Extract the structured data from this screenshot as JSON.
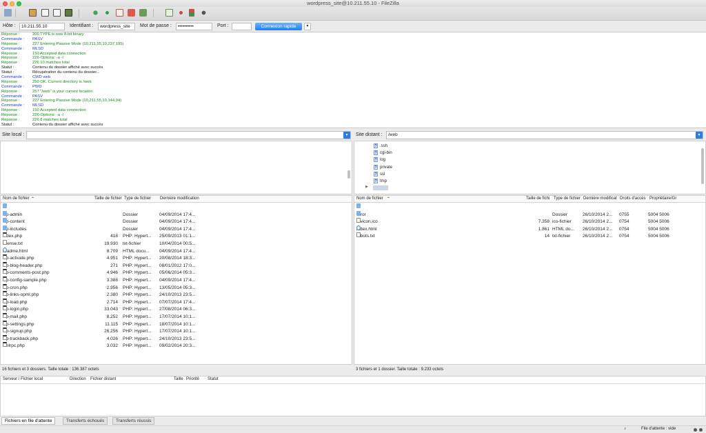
{
  "window": {
    "title": "wordpress_site@10.211.55.10 - FileZilla"
  },
  "quickconnect": {
    "host_label": "Hôte :",
    "host_value": "10.211.55.10",
    "user_label": "Identifiant :",
    "user_value": "wordpress_site",
    "pass_label": "Mot de passe :",
    "pass_value": "••••••••••",
    "port_label": "Port :",
    "port_value": "",
    "connect_label": "Connexion rapide",
    "dropdown_glyph": "▼"
  },
  "log": [
    {
      "k": "Réponse :",
      "v": "200 TYPE is now 8-bit binary",
      "t": "rep"
    },
    {
      "k": "Commande :",
      "v": "PASV",
      "t": "cmd"
    },
    {
      "k": "Réponse :",
      "v": "227 Entering Passive Mode (10,211,55,10,237,195)",
      "t": "rep"
    },
    {
      "k": "Commande :",
      "v": "MLSD",
      "t": "cmd"
    },
    {
      "k": "Réponse :",
      "v": "150 Accepted data connection",
      "t": "rep"
    },
    {
      "k": "Réponse :",
      "v": "226-Options: -a -l",
      "t": "rep"
    },
    {
      "k": "Réponse :",
      "v": "226 10 matches total",
      "t": "rep"
    },
    {
      "k": "Statut :",
      "v": "Contenu du dossier affiché avec succès",
      "t": "stat"
    },
    {
      "k": "Statut :",
      "v": "Récupération du contenu du dossier...",
      "t": "stat"
    },
    {
      "k": "Commande :",
      "v": "CWD web",
      "t": "cmd"
    },
    {
      "k": "Réponse :",
      "v": "250 OK. Current directory is /web",
      "t": "rep"
    },
    {
      "k": "Commande :",
      "v": "PWD",
      "t": "cmd"
    },
    {
      "k": "Réponse :",
      "v": "257 \"/web\" is your current location",
      "t": "rep"
    },
    {
      "k": "Commande :",
      "v": "PASV",
      "t": "cmd"
    },
    {
      "k": "Réponse :",
      "v": "227 Entering Passive Mode (10,211,55,10,144,94)",
      "t": "rep"
    },
    {
      "k": "Commande :",
      "v": "MLSD",
      "t": "cmd"
    },
    {
      "k": "Réponse :",
      "v": "150 Accepted data connection",
      "t": "rep"
    },
    {
      "k": "Réponse :",
      "v": "226-Options: -a -l",
      "t": "rep"
    },
    {
      "k": "Réponse :",
      "v": "226 8 matches total",
      "t": "rep"
    },
    {
      "k": "Statut :",
      "v": "Contenu du dossier affiché avec succès",
      "t": "stat"
    }
  ],
  "local": {
    "site_label": "Site local :",
    "site_value": "",
    "headers": {
      "name": "Nom de fichier",
      "size": "Taille de fichier",
      "type": "Type de fichier",
      "modified": "Dernière modification"
    },
    "files": [
      {
        "name": "..",
        "size": "",
        "type": "",
        "modified": "",
        "icon": "folder"
      },
      {
        "name": "wp-admin",
        "size": "",
        "type": "Dossier",
        "modified": "04/09/2014 17:4...",
        "icon": "folder"
      },
      {
        "name": "wp-content",
        "size": "",
        "type": "Dossier",
        "modified": "04/09/2014 17:4...",
        "icon": "folder"
      },
      {
        "name": "wp-includes",
        "size": "",
        "type": "Dossier",
        "modified": "04/09/2014 17:4...",
        "icon": "folder"
      },
      {
        "name": "index.php",
        "size": "418",
        "type": "PHP: Hypert...",
        "modified": "25/09/2013 01:1...",
        "icon": "php"
      },
      {
        "name": "license.txt",
        "size": "19.930",
        "type": "txt-fichier",
        "modified": "10/04/2014 00:5...",
        "icon": "file"
      },
      {
        "name": "readme.html",
        "size": "8.709",
        "type": "HTML docu...",
        "modified": "04/09/2014 17:4...",
        "icon": "html"
      },
      {
        "name": "wp-activate.php",
        "size": "4.951",
        "type": "PHP: Hypert...",
        "modified": "20/08/2014 18:3...",
        "icon": "php"
      },
      {
        "name": "wp-blog-header.php",
        "size": "271",
        "type": "PHP: Hypert...",
        "modified": "08/01/2012 17:0...",
        "icon": "php"
      },
      {
        "name": "wp-comments-post.php",
        "size": "4.946",
        "type": "PHP: Hypert...",
        "modified": "05/06/2014 05:3...",
        "icon": "php"
      },
      {
        "name": "wp-config-sample.php",
        "size": "3.388",
        "type": "PHP: Hypert...",
        "modified": "04/09/2014 17:4...",
        "icon": "php"
      },
      {
        "name": "wp-cron.php",
        "size": "2.956",
        "type": "PHP: Hypert...",
        "modified": "13/05/2014 05:3...",
        "icon": "php"
      },
      {
        "name": "wp-links-opml.php",
        "size": "2.380",
        "type": "PHP: Hypert...",
        "modified": "24/10/2013 23:5...",
        "icon": "php"
      },
      {
        "name": "wp-load.php",
        "size": "2.714",
        "type": "PHP: Hypert...",
        "modified": "07/07/2014 17:4...",
        "icon": "php"
      },
      {
        "name": "wp-login.php",
        "size": "33.043",
        "type": "PHP: Hypert...",
        "modified": "27/08/2014 06:3...",
        "icon": "php"
      },
      {
        "name": "wp-mail.php",
        "size": "8.252",
        "type": "PHP: Hypert...",
        "modified": "17/07/2014 10:1...",
        "icon": "php"
      },
      {
        "name": "wp-settings.php",
        "size": "11.115",
        "type": "PHP: Hypert...",
        "modified": "18/07/2014 10:1...",
        "icon": "php"
      },
      {
        "name": "wp-signup.php",
        "size": "26.256",
        "type": "PHP: Hypert...",
        "modified": "17/07/2014 10:1...",
        "icon": "php"
      },
      {
        "name": "wp-trackback.php",
        "size": "4.026",
        "type": "PHP: Hypert...",
        "modified": "24/10/2013 23:5...",
        "icon": "php"
      },
      {
        "name": "xmlrpc.php",
        "size": "3.032",
        "type": "PHP: Hypert...",
        "modified": "09/02/2014 20:3...",
        "icon": "php"
      }
    ],
    "status": "16 fichiers et 3 dossiers. Taille totale : 136.387 octets"
  },
  "remote": {
    "site_label": "Site distant :",
    "site_value": "/web",
    "tree": [
      ".ssh",
      "cgi-bin",
      "log",
      "private",
      "ssl",
      "tmp"
    ],
    "headers": {
      "name": "Nom de fichier",
      "size": "Taille de fichi",
      "type": "Type de fichier",
      "modified": "Dernière modificat",
      "perms": "Droits d'accès",
      "owner": "Propriétaire/Gr"
    },
    "files": [
      {
        "name": "..",
        "size": "",
        "type": "",
        "modified": "",
        "perms": "",
        "owner": "",
        "icon": "folder"
      },
      {
        "name": "error",
        "size": "",
        "type": "Dossier",
        "modified": "26/10/2014 2...",
        "perms": "0755",
        "owner": "5004 5006",
        "icon": "folder"
      },
      {
        "name": "favicon.ico",
        "size": "7.358",
        "type": "ico-fichier",
        "modified": "26/10/2014 2...",
        "perms": "0754",
        "owner": "5004 5006",
        "icon": "file"
      },
      {
        "name": "index.html",
        "size": "1.861",
        "type": "HTML do...",
        "modified": "26/10/2014 2...",
        "perms": "0754",
        "owner": "5004 5006",
        "icon": "html"
      },
      {
        "name": "robots.txt",
        "size": "14",
        "type": "txt-fichier",
        "modified": "26/10/2014 2...",
        "perms": "0754",
        "owner": "5004 5006",
        "icon": "file"
      }
    ],
    "status": "3 fichiers et 1 dossier. Taille totale : 9.233 octets"
  },
  "queue": {
    "headers": {
      "server": "Serveur / Fichier local",
      "direction": "Direction",
      "remote": "Fichier distant",
      "size": "Taille",
      "priority": "Priorité",
      "status": "Statut"
    },
    "tabs": [
      "Fichiers en file d'attente",
      "Transferts échoués",
      "Transferts réussis"
    ],
    "status_text": "File d'attente : vide"
  },
  "colors": {
    "command": "#1a3fd1",
    "response": "#178a17",
    "status": "#111111",
    "accent": "#2a7de1"
  }
}
